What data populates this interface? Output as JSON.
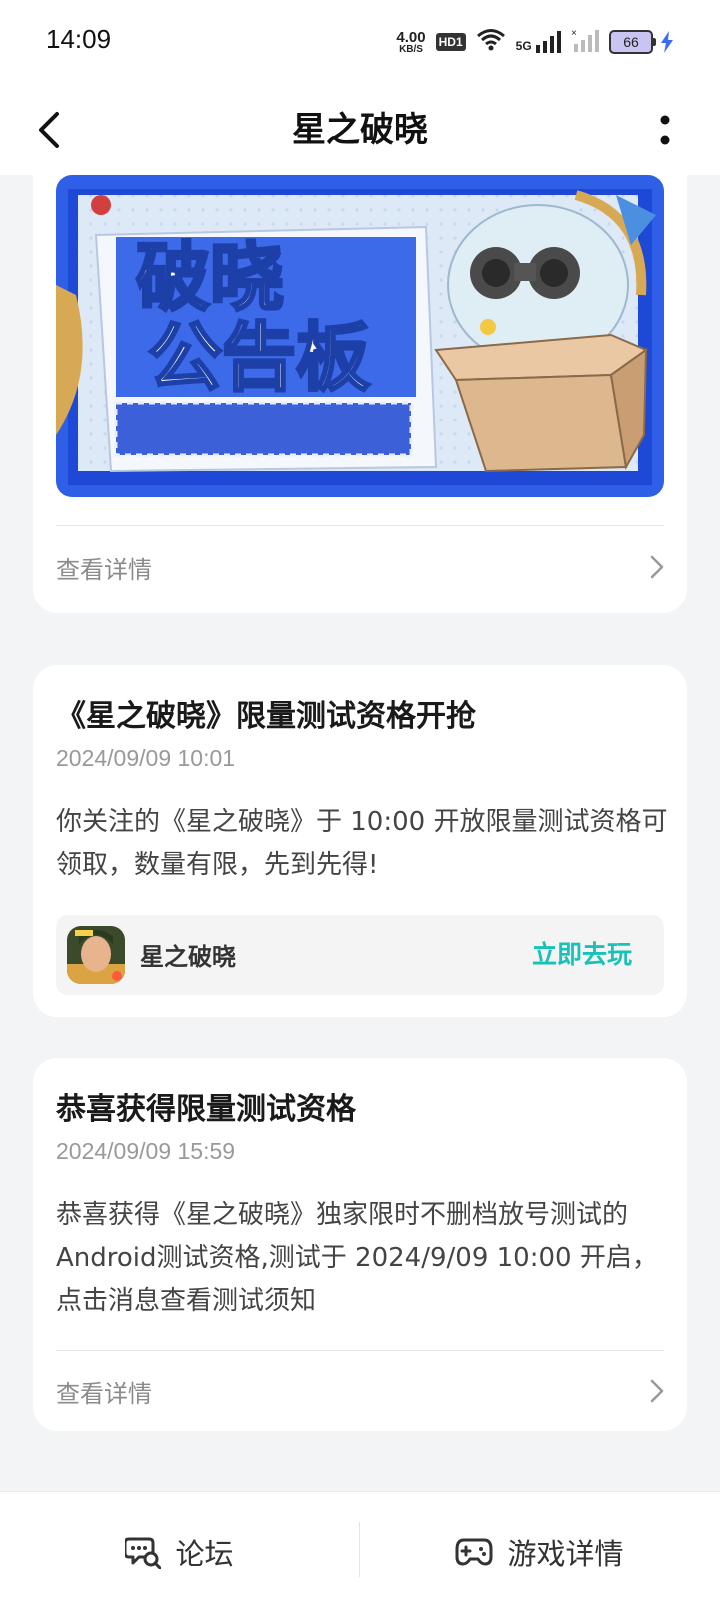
{
  "status_bar": {
    "time": "14:09",
    "net_speed_value": "4.00",
    "net_speed_unit": "KB/S",
    "hd_label": "HD1",
    "network_label": "5G",
    "battery_level": "66"
  },
  "header": {
    "title": "星之破晓",
    "back_icon": "back-arrow-icon",
    "more_icon": "more-vertical-icon"
  },
  "cards": [
    {
      "banner_text_line1": "破晓",
      "banner_text_line2": "公告板",
      "detail_label": "查看详情"
    },
    {
      "title": "《星之破晓》限量测试资格开抢",
      "date": "2024/09/09 10:01",
      "body": "你关注的《星之破晓》于 10:00 开放限量测试资格可领取，数量有限，先到先得!",
      "game_name": "星之破晓",
      "play_label": "立即去玩"
    },
    {
      "title": "恭喜获得限量测试资格",
      "date": "2024/09/09 15:59",
      "body": "恭喜获得《星之破晓》独家限时不删档放号测试的Android测试资格,测试于 2024/9/09 10:00 开启，点击消息查看测试须知",
      "detail_label": "查看详情"
    }
  ],
  "bottom_bar": {
    "forum_label": "论坛",
    "game_detail_label": "游戏详情"
  },
  "colors": {
    "accent": "#19c2b9",
    "banner_blue": "#2f5fe6",
    "page_bg": "#f3f4f6"
  }
}
